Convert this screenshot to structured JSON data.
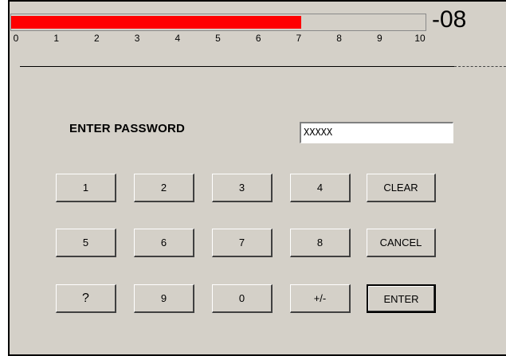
{
  "progress": {
    "value": 7,
    "max": 10,
    "scale": [
      "0",
      "1",
      "2",
      "3",
      "4",
      "5",
      "6",
      "7",
      "8",
      "9",
      "10"
    ],
    "color": "#ff0000"
  },
  "exponent": "-08",
  "password": {
    "label": "ENTER PASSWORD",
    "value": "XXXXX"
  },
  "keypad": {
    "rows": [
      [
        "1",
        "2",
        "3",
        "4",
        "CLEAR"
      ],
      [
        "5",
        "6",
        "7",
        "8",
        "CANCEL"
      ],
      [
        "?",
        "9",
        "0",
        "+/-",
        "ENTER"
      ]
    ]
  }
}
